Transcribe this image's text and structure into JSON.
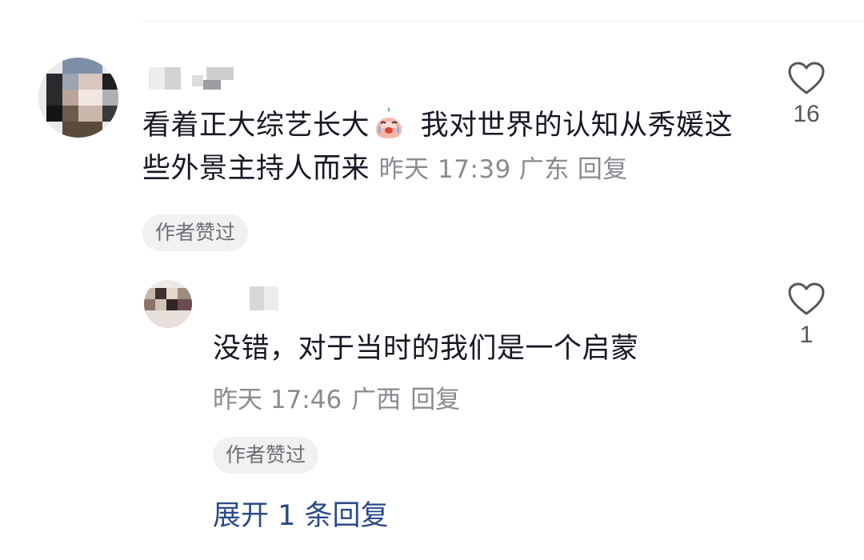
{
  "comments": [
    {
      "text": "看着正大综艺长大",
      "text_after_emoji": " 我对世界的认知从秀媛这些外景主持人而来",
      "emoji_name": "crying-emoji",
      "time": "昨天 17:39",
      "location": "广东",
      "reply_label": "回复",
      "author_badge": "作者赞过",
      "likes": "16"
    },
    {
      "text": "没错，对于当时的我们是一个启蒙",
      "time": "昨天 17:46",
      "location": "广西",
      "reply_label": "回复",
      "author_badge": "作者赞过",
      "likes": "1"
    }
  ],
  "expand_replies": "展开 1 条回复",
  "colors": {
    "text": "#161823",
    "meta": "#8a8b91",
    "link": "#2b4a8a",
    "pill_bg": "#f1f1f2"
  }
}
